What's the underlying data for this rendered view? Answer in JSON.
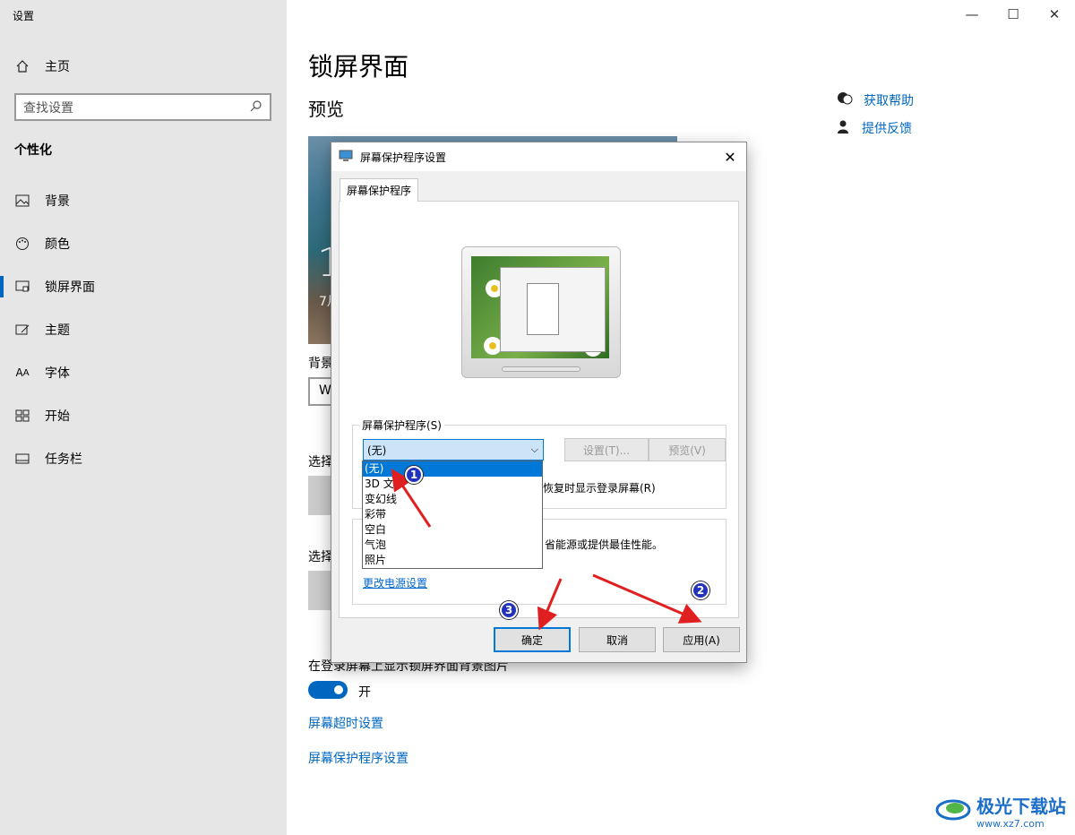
{
  "app_title": "设置",
  "sidebar": {
    "home": "主页",
    "search_placeholder": "查找设置",
    "section": "个性化",
    "items": [
      {
        "label": "背景",
        "icon": "picture-icon"
      },
      {
        "label": "颜色",
        "icon": "palette-icon"
      },
      {
        "label": "锁屏界面",
        "icon": "lockscreen-icon",
        "active": true
      },
      {
        "label": "主题",
        "icon": "theme-icon"
      },
      {
        "label": "字体",
        "icon": "font-icon"
      },
      {
        "label": "开始",
        "icon": "start-icon"
      },
      {
        "label": "任务栏",
        "icon": "taskbar-icon"
      }
    ]
  },
  "main": {
    "title": "锁屏界面",
    "preview_heading": "预览",
    "preview_time": "1",
    "preview_date": "7月",
    "background_label": "背景",
    "background_value": "W",
    "choose_app_label": "选择",
    "choose_app_label2": "选择",
    "show_bg_label": "在登录屏幕上显示锁屏界面背景图片",
    "toggle_text": "开",
    "link_timeout": "屏幕超时设置",
    "link_screensaver": "屏幕保护程序设置",
    "help": "获取帮助",
    "feedback": "提供反馈"
  },
  "dialog": {
    "title": "屏幕保护程序设置",
    "tab": "屏幕保护程序",
    "group_label": "屏幕保护程序(S)",
    "combo_value": "(无)",
    "settings_btn": "设置(T)...",
    "preview_btn": "预览(V)",
    "checkbox_text": "恢复时显示登录屏幕(R)",
    "power_text": "省能源或提供最佳性能。",
    "power_link": "更改电源设置",
    "dropdown_options": [
      "(无)",
      "3D 文字",
      "变幻线",
      "彩带",
      "空白",
      "气泡",
      "照片"
    ],
    "dropdown_selected": "(无)",
    "ok": "确定",
    "cancel": "取消",
    "apply": "应用(A)"
  },
  "annotations": {
    "badge1": "1",
    "badge2": "2",
    "badge3": "3",
    "arrow_color": "#e02020"
  },
  "watermark": {
    "title": "极光下载站",
    "url": "www.xz7.com"
  }
}
